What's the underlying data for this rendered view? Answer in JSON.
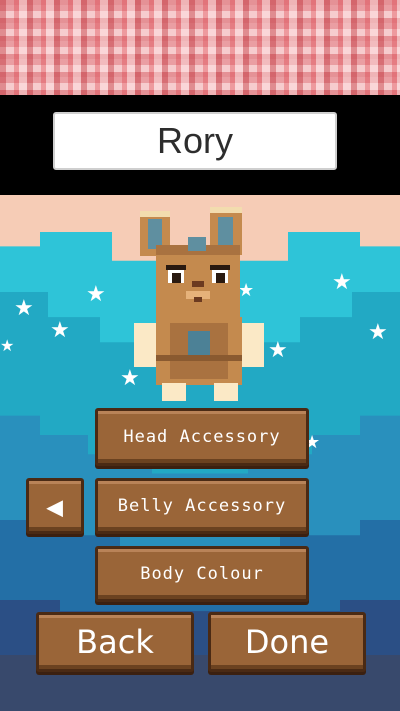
{
  "player": {
    "name": "Rory"
  },
  "menu": {
    "head_accessory": "Head Accessory",
    "belly_accessory": "Belly Accessory",
    "body_colour": "Body Colour",
    "prev_icon": "◀"
  },
  "footer": {
    "back": "Back",
    "done": "Done"
  },
  "character": {
    "type": "blocky-bunny",
    "fur_color": "#c48a4e",
    "belly_color": "#fbe9c6",
    "ear_inner_color": "#5f8fa0",
    "belly_patch_color": "#4c8196"
  },
  "colors": {
    "button_fill": "#9a6538",
    "button_border": "#4a2a14",
    "sky_peach": "#f6ccb6",
    "sky_cyan": "#2ec4d8",
    "sky_navy": "#2b4f85"
  },
  "icons": {
    "star": "star-icon"
  }
}
